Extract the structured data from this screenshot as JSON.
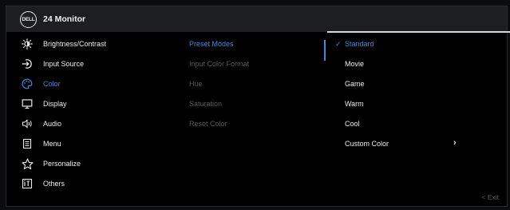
{
  "header": {
    "logo_text": "DELL",
    "title": "24 Monitor"
  },
  "menu": {
    "items": [
      {
        "label": "Brightness/Contrast",
        "icon": "brightness-icon",
        "active": false
      },
      {
        "label": "Input Source",
        "icon": "input-source-icon",
        "active": false
      },
      {
        "label": "Color",
        "icon": "color-palette-icon",
        "active": true
      },
      {
        "label": "Display",
        "icon": "display-icon",
        "active": false
      },
      {
        "label": "Audio",
        "icon": "speaker-icon",
        "active": false
      },
      {
        "label": "Menu",
        "icon": "menu-icon",
        "active": false
      },
      {
        "label": "Personalize",
        "icon": "star-icon",
        "active": false
      },
      {
        "label": "Others",
        "icon": "others-icon",
        "active": false
      }
    ]
  },
  "submenu": {
    "items": [
      {
        "label": "Preset Modes",
        "active": true
      },
      {
        "label": "Input Color Format",
        "active": false
      },
      {
        "label": "Hue",
        "active": false
      },
      {
        "label": "Saturation",
        "active": false
      },
      {
        "label": "Reset Color",
        "active": false
      }
    ]
  },
  "options": {
    "items": [
      {
        "label": "Standard",
        "selected": true,
        "has_submenu": false
      },
      {
        "label": "Movie",
        "selected": false,
        "has_submenu": false
      },
      {
        "label": "Game",
        "selected": false,
        "has_submenu": false
      },
      {
        "label": "Warm",
        "selected": false,
        "has_submenu": false
      },
      {
        "label": "Cool",
        "selected": false,
        "has_submenu": false
      },
      {
        "label": "Custom Color",
        "selected": false,
        "has_submenu": true
      }
    ],
    "check_glyph": "✓",
    "chevron_glyph": "›"
  },
  "footer": {
    "exit_label": "< Exit"
  },
  "colors": {
    "accent": "#3d8bdd",
    "background": "#000000",
    "header": "#1d1e20",
    "disabled_text": "#5a5a5a"
  }
}
